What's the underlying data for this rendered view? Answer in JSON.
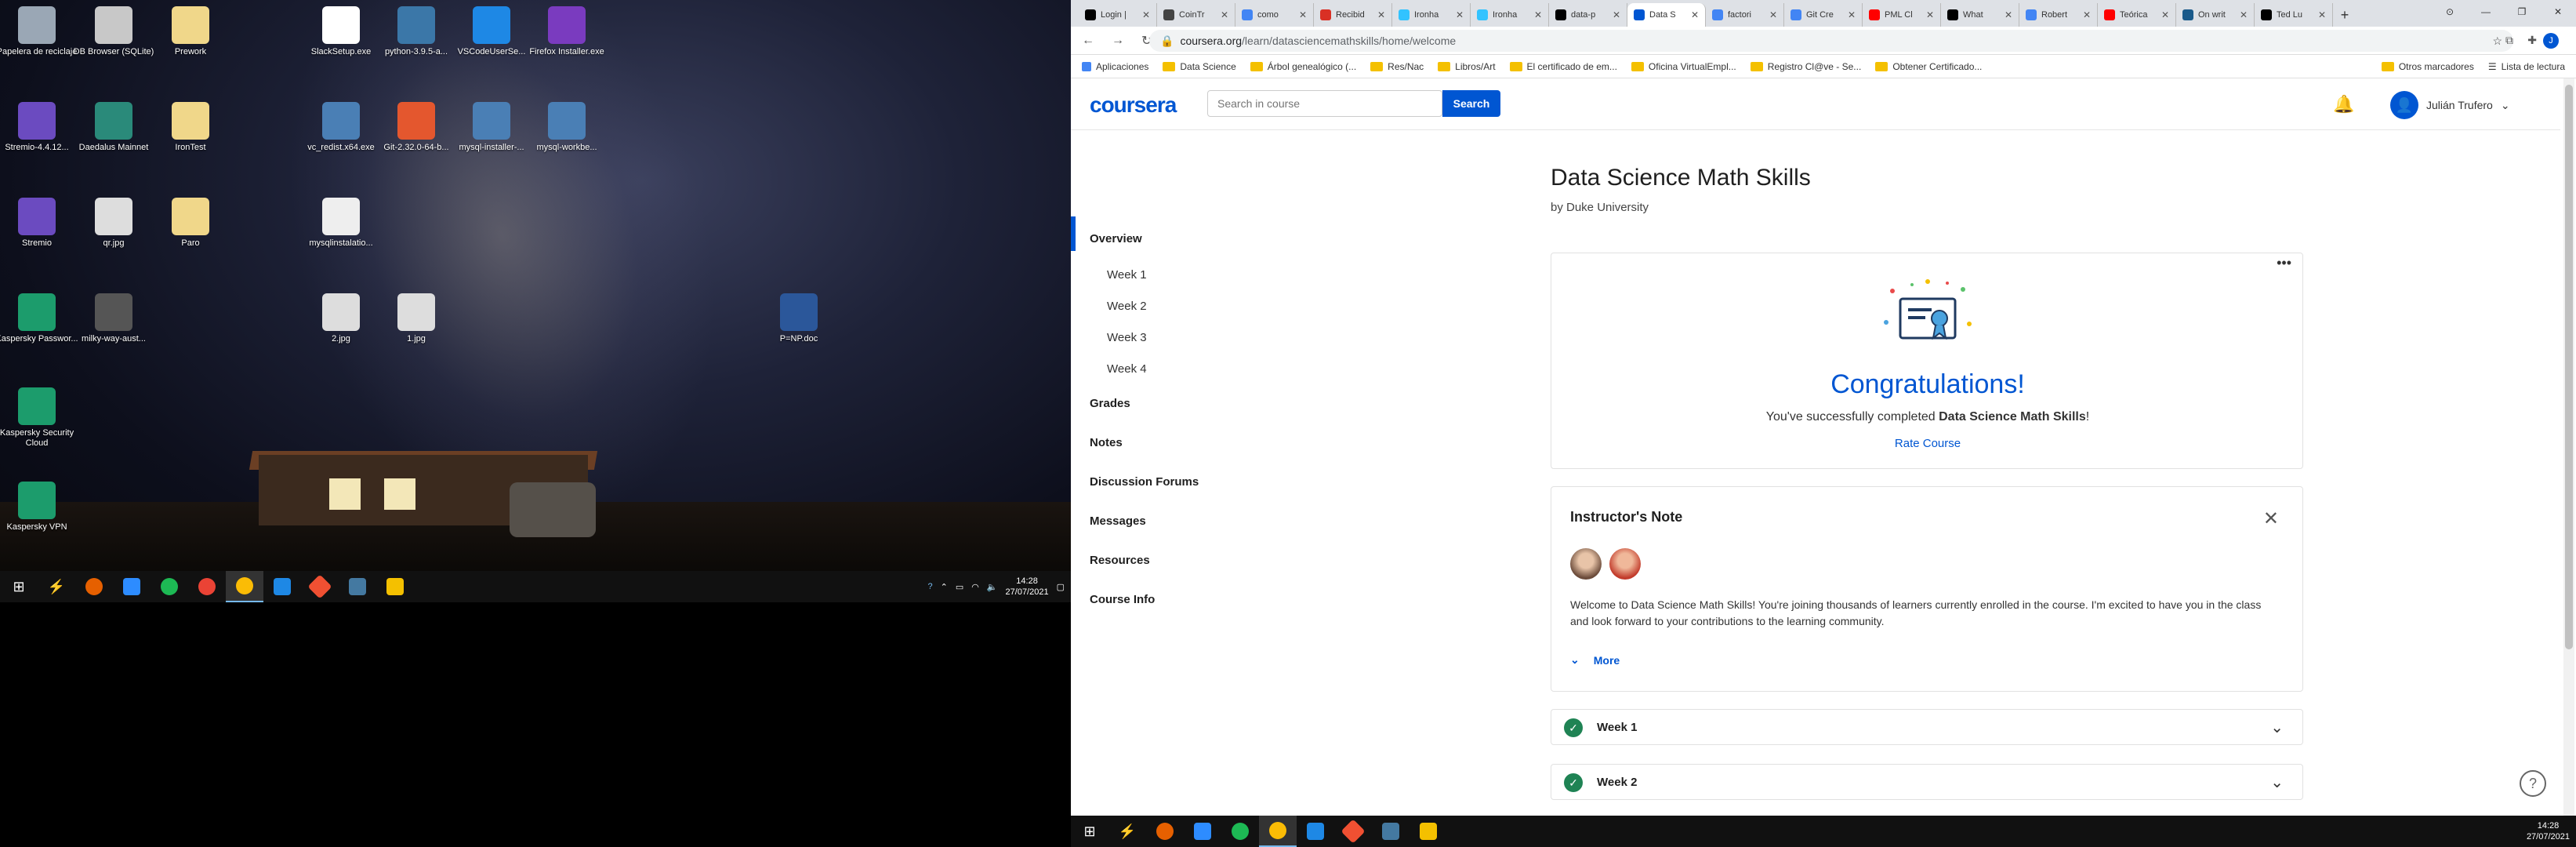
{
  "desktop": {
    "icons": [
      {
        "label": "Papelera de reciclaje",
        "icon": "recycle-bin-icon",
        "color": "#9aa7b5"
      },
      {
        "label": "DB Browser (SQLite)",
        "icon": "database-icon",
        "color": "#c8c8c8"
      },
      {
        "label": "Prework",
        "icon": "folder-icon",
        "color": "#f0d78a"
      },
      {
        "label": "SlackSetup.exe",
        "icon": "slack-icon",
        "color": "#ffffff"
      },
      {
        "label": "python-3.9.5-a...",
        "icon": "python-icon",
        "color": "#3b77a8"
      },
      {
        "label": "VSCodeUserSe...",
        "icon": "vscode-icon",
        "color": "#1e88e5"
      },
      {
        "label": "Firefox Installer.exe",
        "icon": "firefox-icon",
        "color": "#7a3bbf"
      },
      {
        "label": "Stremio-4.4.12...",
        "icon": "stremio-icon",
        "color": "#6b4bc0"
      },
      {
        "label": "Daedalus Mainnet",
        "icon": "daedalus-icon",
        "color": "#2a8a7a"
      },
      {
        "label": "IronTest",
        "icon": "folder-icon",
        "color": "#f0d78a"
      },
      {
        "label": "vc_redist.x64.exe",
        "icon": "installer-icon",
        "color": "#4a7fb5"
      },
      {
        "label": "Git-2.32.0-64-b...",
        "icon": "git-icon",
        "color": "#e4572e"
      },
      {
        "label": "mysql-installer-...",
        "icon": "installer-icon",
        "color": "#4a7fb5"
      },
      {
        "label": "mysql-workbe...",
        "icon": "installer-icon",
        "color": "#4a7fb5"
      },
      {
        "label": "Stremio",
        "icon": "stremio-icon",
        "color": "#6b4bc0"
      },
      {
        "label": "qr.jpg",
        "icon": "image-file-icon",
        "color": "#dddddd"
      },
      {
        "label": "Paro",
        "icon": "document-icon",
        "color": "#f0d78a"
      },
      {
        "label": "mysqlinstalatio...",
        "icon": "document-icon",
        "color": "#eeeeee"
      },
      {
        "label": "Kaspersky Passwor...",
        "icon": "kaspersky-icon",
        "color": "#1c9c6c"
      },
      {
        "label": "milky-way-aust...",
        "icon": "image-file-icon",
        "color": "#555555"
      },
      {
        "label": "2.jpg",
        "icon": "image-file-icon",
        "color": "#dddddd"
      },
      {
        "label": "1.jpg",
        "icon": "image-file-icon",
        "color": "#dddddd"
      },
      {
        "label": "P=NP.doc",
        "icon": "word-doc-icon",
        "color": "#2b579a"
      },
      {
        "label": "Kaspersky Security Cloud",
        "icon": "kaspersky-icon",
        "color": "#1c9c6c"
      },
      {
        "label": "Kaspersky VPN",
        "icon": "kaspersky-icon",
        "color": "#1c9c6c"
      }
    ],
    "taskbar": {
      "time": "14:28",
      "date": "27/07/2021"
    }
  },
  "browser": {
    "tabs": [
      {
        "label": "Login |",
        "color": "#000000"
      },
      {
        "label": "CoinTr",
        "color": "#444444"
      },
      {
        "label": "como",
        "color": "#4285f4"
      },
      {
        "label": "Recibid",
        "color": "#d93025"
      },
      {
        "label": "Ironha",
        "color": "#32c3ff"
      },
      {
        "label": "Ironha",
        "color": "#32c3ff"
      },
      {
        "label": "data-p",
        "color": "#000000"
      },
      {
        "label": "Data S",
        "color": "#0056d2",
        "active": true
      },
      {
        "label": "factori",
        "color": "#4285f4"
      },
      {
        "label": "Git Cre",
        "color": "#4285f4"
      },
      {
        "label": "PML Cl",
        "color": "#ff0000"
      },
      {
        "label": "What",
        "color": "#000000"
      },
      {
        "label": "Robert",
        "color": "#4285f4"
      },
      {
        "label": "Teórica",
        "color": "#ff0000"
      },
      {
        "label": "On writ",
        "color": "#1a5a8a"
      },
      {
        "label": "Ted Lu",
        "color": "#000000"
      }
    ],
    "url_host": "coursera.org",
    "url_path": "/learn/datasciencemathskills/home/welcome",
    "bookmarks": [
      "Aplicaciones",
      "Data Science",
      "Árbol genealógico (...",
      "Res/Nac",
      "Libros/Art",
      "El certificado de em...",
      "Oficina VirtualEmpl...",
      "Registro Cl@ve - Se...",
      "Obtener Certificado..."
    ],
    "bookmarks_right": [
      "Otros marcadores",
      "Lista de lectura"
    ]
  },
  "coursera": {
    "logo": "coursera",
    "search_placeholder": "Search in course",
    "search_button": "Search",
    "user_name": "Julián Trufero",
    "course_title": "Data Science Math Skills",
    "byline": "by Duke University",
    "nav": {
      "overview": "Overview",
      "weeks": [
        "Week 1",
        "Week 2",
        "Week 3",
        "Week 4"
      ],
      "grades": "Grades",
      "notes": "Notes",
      "forums": "Discussion Forums",
      "messages": "Messages",
      "resources": "Resources",
      "info": "Course Info"
    },
    "congrats": {
      "heading": "Congratulations!",
      "text_before": "You've successfully completed ",
      "course": "Data Science Math Skills",
      "text_after": "!",
      "rate": "Rate Course"
    },
    "note": {
      "heading": "Instructor's Note",
      "body": "Welcome to Data Science Math Skills! You're joining thousands of learners currently enrolled in the course. I'm excited to have you in the class and look forward to your contributions to the learning community.",
      "more": "More"
    },
    "week_rows": [
      "Week 1",
      "Week 2"
    ],
    "brand_color": "#0056d2",
    "success_color": "#1f8354"
  }
}
